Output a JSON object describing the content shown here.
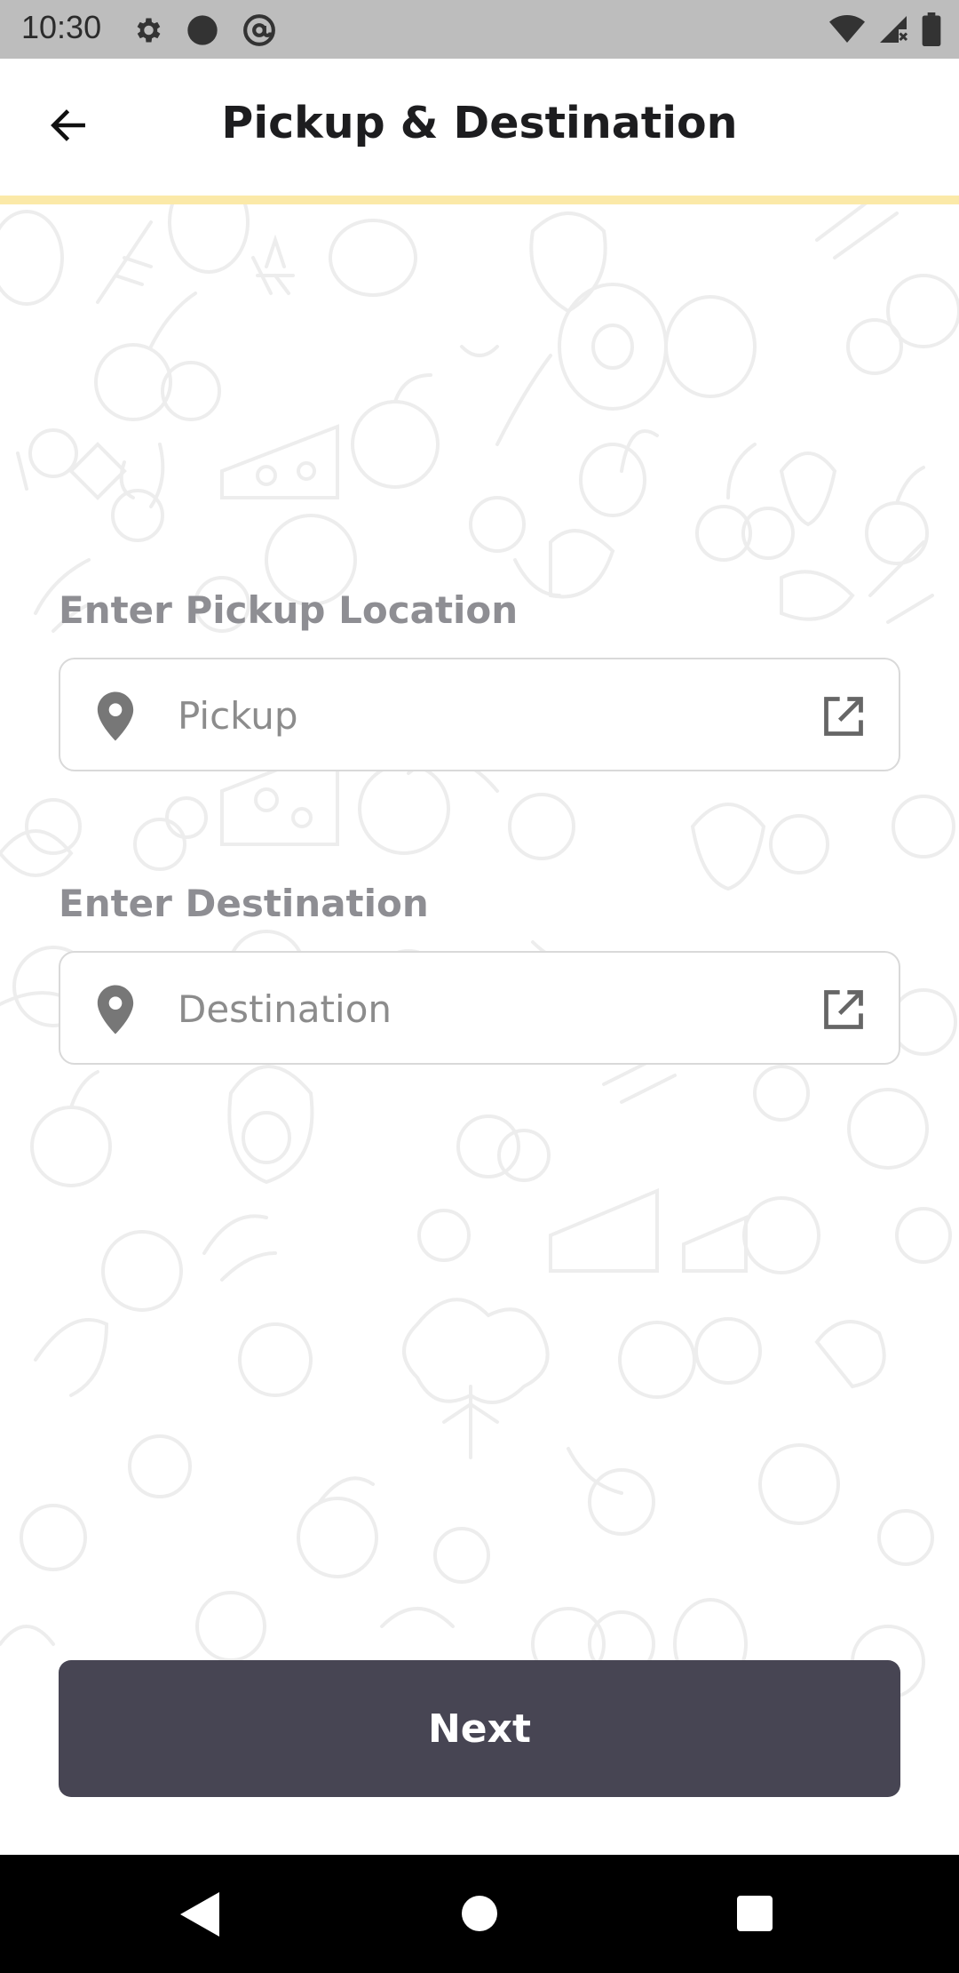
{
  "status_bar": {
    "time": "10:30",
    "left_icons": [
      "settings-icon",
      "circle-dot-icon",
      "at-sign-icon"
    ],
    "right_icons": [
      "wifi-icon",
      "signal-icon",
      "battery-icon"
    ]
  },
  "app_bar": {
    "title": "Pickup & Destination",
    "back_icon": "arrow-left-icon"
  },
  "form": {
    "pickup": {
      "label": "Enter Pickup Location",
      "placeholder": "Pickup",
      "value": "",
      "icon": "location-pin-icon",
      "action_icon": "open-external-icon"
    },
    "destination": {
      "label": "Enter Destination",
      "placeholder": "Destination",
      "value": "",
      "icon": "location-pin-icon",
      "action_icon": "open-external-icon"
    }
  },
  "next_button": {
    "label": "Next"
  },
  "nav_bar": {
    "icons": [
      "nav-back-icon",
      "nav-home-icon",
      "nav-recents-icon"
    ]
  },
  "colors": {
    "accent": "#fbe9a8",
    "button": "#474553",
    "status_bar": "#bdbdbd",
    "label": "#8e8e93"
  }
}
